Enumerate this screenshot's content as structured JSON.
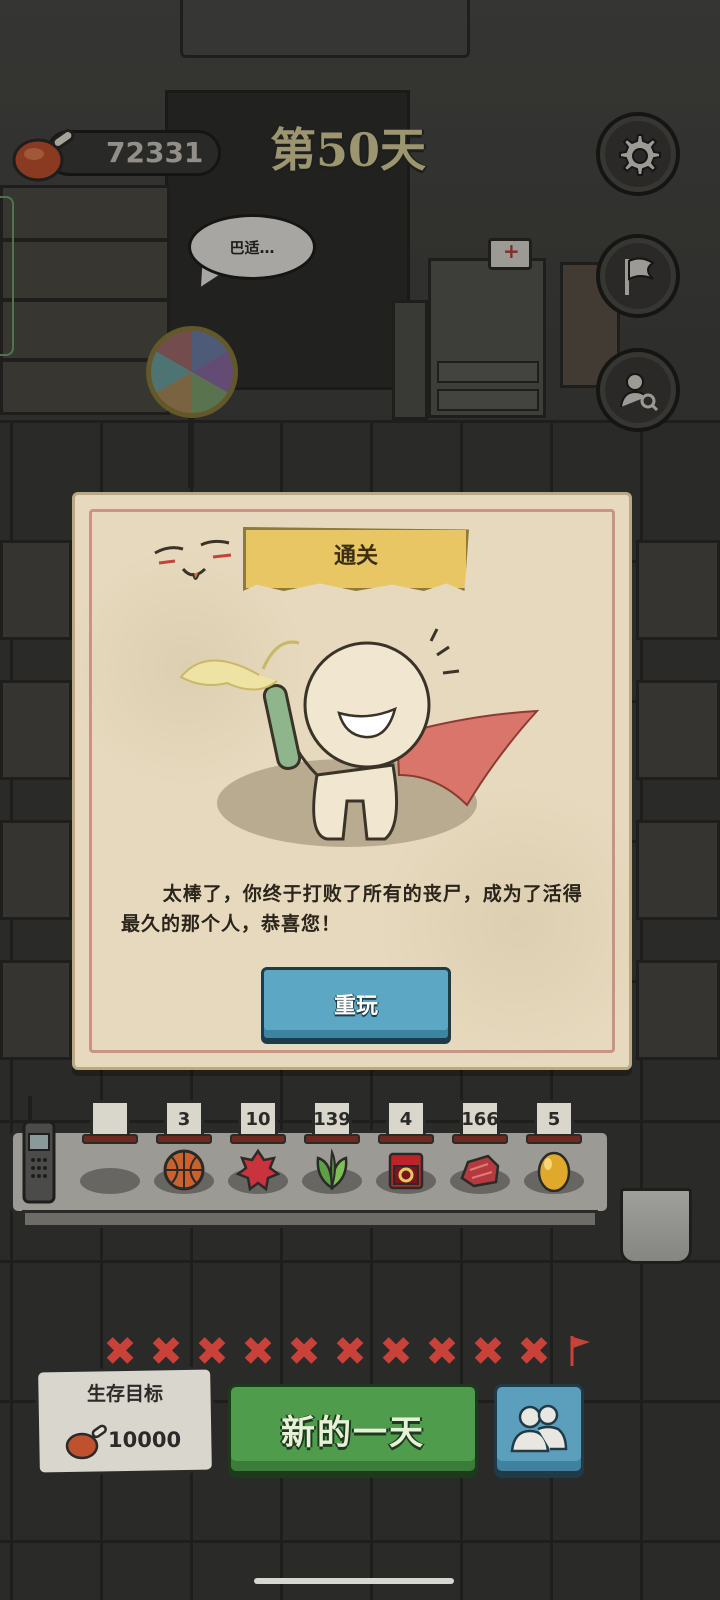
{
  "hud": {
    "meat_count": "72331",
    "day_label": "第50天",
    "speech_bubble": "巴适…"
  },
  "modal": {
    "title": "通关",
    "message": "太棒了，你终于打败了所有的丧尸，成为了活得最久的那个人，恭喜您！",
    "replay_label": "重玩"
  },
  "inventory": [
    {
      "count": "",
      "icon": "empty-slot-icon"
    },
    {
      "count": "3",
      "icon": "basketball-icon"
    },
    {
      "count": "10",
      "icon": "dragon-fruit-icon"
    },
    {
      "count": "139",
      "icon": "herb-leaf-icon"
    },
    {
      "count": "4",
      "icon": "ring-box-icon"
    },
    {
      "count": "166",
      "icon": "raw-meat-icon"
    },
    {
      "count": "5",
      "icon": "golden-egg-icon"
    }
  ],
  "progress": {
    "completed_crosses": 10,
    "cross_glyph": "✖"
  },
  "bottom": {
    "goal_title": "生存目标",
    "goal_value": "10000",
    "new_day_label": "新的一天"
  },
  "colors": {
    "modal_bg": "#e6d9bd",
    "ribbon": "#e8c663",
    "replay_button": "#5ba7c4",
    "new_day_button": "#4f9d4c",
    "cross_red": "#c8423a"
  }
}
